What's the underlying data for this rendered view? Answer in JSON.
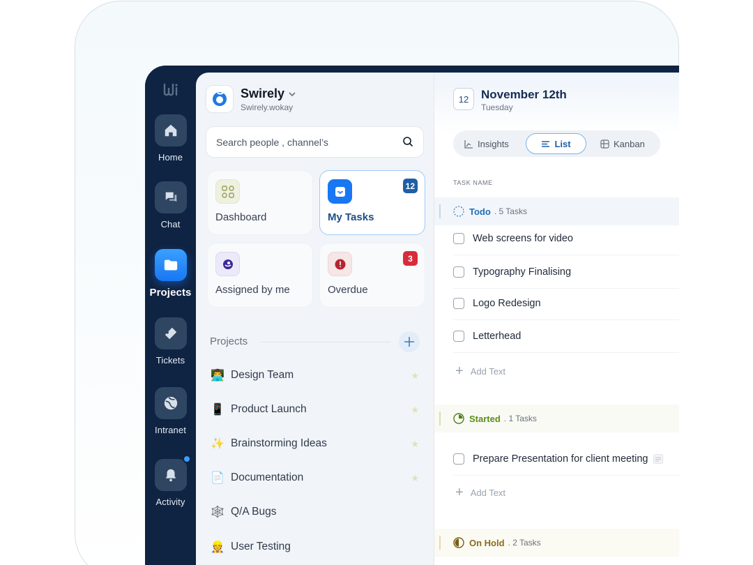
{
  "workspace": {
    "name": "Swirely",
    "subtitle": "Swirely.wokay"
  },
  "search": {
    "placeholder": "Search people , channel’s"
  },
  "rail": {
    "items": [
      {
        "label": "Home",
        "icon": "home-icon"
      },
      {
        "label": "Chat",
        "icon": "chat-icon"
      },
      {
        "label": "Projects",
        "icon": "folder-icon",
        "active": true
      },
      {
        "label": "Tickets",
        "icon": "ticket-icon"
      },
      {
        "label": "Intranet",
        "icon": "globe-icon"
      },
      {
        "label": "Activity",
        "icon": "bell-icon",
        "notification": true
      }
    ]
  },
  "cards": [
    {
      "label": "Dashboard",
      "icon": "dashboard-icon"
    },
    {
      "label": "My Tasks",
      "icon": "inbox-icon",
      "badge": "12",
      "active": true
    },
    {
      "label": "Assigned by me",
      "icon": "assigned-icon"
    },
    {
      "label": "Overdue",
      "icon": "alert-icon",
      "badge": "3"
    }
  ],
  "projects": {
    "heading": "Projects",
    "items": [
      {
        "emoji": "👨‍💻",
        "name": "Design Team",
        "starred": true
      },
      {
        "emoji": "📱",
        "name": "Product Launch",
        "starred": true
      },
      {
        "emoji": "✨",
        "name": "Brainstorming Ideas",
        "starred": true
      },
      {
        "emoji": "📄",
        "name": "Documentation",
        "starred": true
      },
      {
        "emoji": "🕸️",
        "name": "Q/A Bugs",
        "starred": false
      },
      {
        "emoji": "👷",
        "name": "User Testing",
        "starred": false
      }
    ]
  },
  "date": {
    "day_number": "12",
    "title": "November 12th",
    "weekday": "Tuesday"
  },
  "tabs": [
    {
      "label": "Insights",
      "icon": "chart-icon"
    },
    {
      "label": "List",
      "icon": "list-icon",
      "active": true
    },
    {
      "label": "Kanban",
      "icon": "kanban-icon"
    }
  ],
  "column_header": "TASK NAME",
  "groups": [
    {
      "name": "Todo",
      "count": ". 5 Tasks",
      "color": "#1f6fb5",
      "tasks": [
        "Web screens for video",
        "Typography Finalising",
        "Logo Redesign",
        "Letterhead"
      ],
      "add_label": "Add Text"
    },
    {
      "name": "Started",
      "count": ". 1 Tasks",
      "color": "#5a8f1b",
      "tasks": [
        "Prepare Presentation for client meeting"
      ],
      "add_label": "Add Text"
    },
    {
      "name": "On Hold",
      "count": ". 2 Tasks",
      "color": "#8a6d1a",
      "tasks": []
    }
  ],
  "colors": {
    "accent": "#1877f2",
    "rail_bg": "#0f2342",
    "badge_blue": "#1f5ea8",
    "badge_red": "#d92b3a"
  }
}
